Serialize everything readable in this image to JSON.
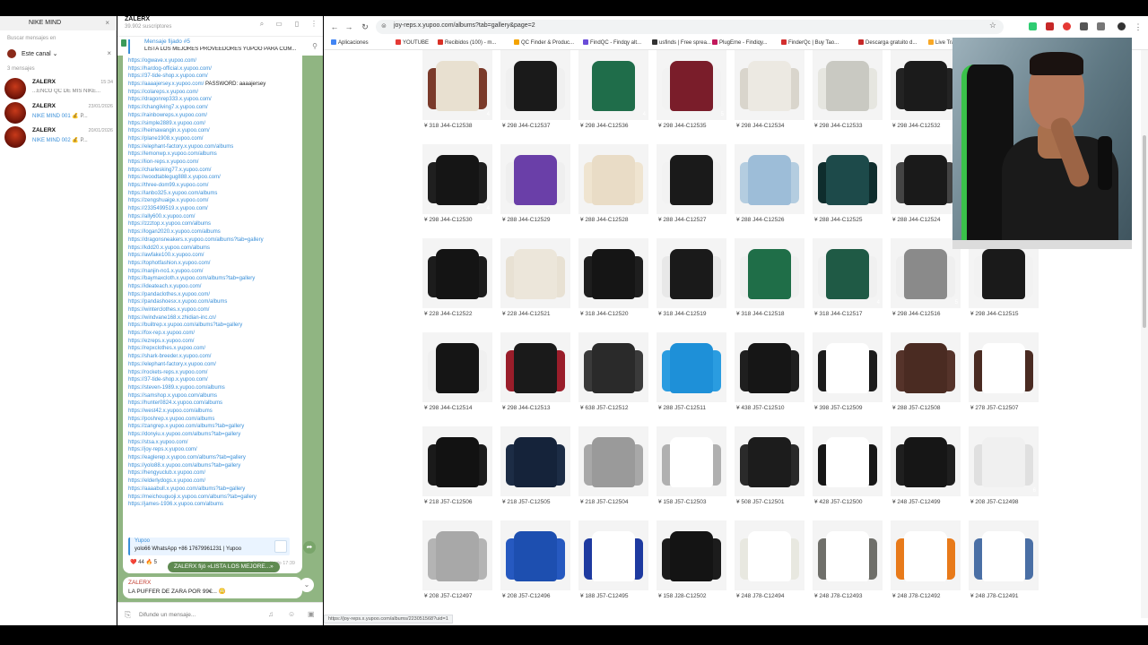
{
  "telegram": {
    "list_search": "NIKE MIND",
    "search_label": "Buscar mensajes en",
    "channel_filter": "Este canal",
    "message_count": "3 mensajes",
    "chats": [
      {
        "name": "ZALERX",
        "time": "15:34",
        "preview_blue": "",
        "preview": "...ENCO QC DE MIS NIKE..."
      },
      {
        "name": "ZALERX",
        "time": "23/01/2026",
        "preview_blue": "NIKE MIND 001",
        "preview": "💰 P..."
      },
      {
        "name": "ZALERX",
        "time": "20/01/2026",
        "preview_blue": "NIKE MIND 002",
        "preview": "💰 P..."
      }
    ],
    "channel_title": "ZALERX",
    "channel_subs": "39.902 suscriptores",
    "pinned_title": "Mensaje fijado #5",
    "pinned_text": "LISTA LOS MEJORES PROVEEDORES YUPOO PARA COM...",
    "links": [
      "https://ogwave.x.yupoo.com/",
      "https://hardog-official.x.yupoo.com/",
      "https://37-tide-shop.x.yupoo.com/",
      "https://aaaajersey.x.yupoo.com/",
      "https://colareps.x.yupoo.com/",
      "https://dragonrep333.x.yupoo.com/",
      "https://changliving7.x.yupoo.com/",
      "https://rainbowreps.x.yupoo.com/",
      "https://simple2889.x.yupoo.com/",
      "https://heimawangin.x.yupoo.com/",
      "https://plane1908.x.yupoo.com/",
      "https://elephant-factory.x.yupoo.com/albums",
      "https://lemonwp.x.yupoo.com/albums",
      "https://lion-reps.x.yupoo.com/",
      "https://charlesking77.x.yupoo.com/",
      "https://woodtablegug888.x.yupoo.com/",
      "https://three-dom99.x.yupoo.com/",
      "https://lanbo325.x.yupoo.com/albums",
      "https://zengshuaige.x.yupoo.com/",
      "https://2335499519.x.yupoo.com/",
      "https://ally600.x.yupoo.com/",
      "https://zzztop.x.yupoo.com/albums",
      "https://logan2020.x.yupoo.com/albums",
      "https://dragonsneakers.x.yupoo.com/albums?tab=gallery",
      "https://kdd20.x.yupoo.com/albums",
      "https://awfake100.x.yupoo.com/",
      "https://tophotfashion.x.yupoo.com/",
      "https://nanjin-no1.x.yupoo.com/",
      "https://baymaxcloth.x.yupoo.com/albums?tab=gallery",
      "https://ideateach.x.yupoo.com/",
      "https://pandaclothes.x.yupoo.com/",
      "https://pandashoesx.x.yupoo.com/albums",
      "https://winterclothes.x.yupoo.com/",
      "https://windvane168.x.zhidian-inc.cn/",
      "https://builtrep.x.yupoo.com/albums?tab=gallery",
      "https://fox-rep.x.yupoo.com/",
      "https://ezreps.x.yupoo.com/",
      "https://repxclothes.x.yupoo.com/",
      "https://shark-breeder.x.yupoo.com/",
      "https://elephant-factory.x.yupoo.com/",
      "https://rockets-reps.x.yupoo.com/",
      "https://37-tide-shop.x.yupoo.com/",
      "https://steven-1989.x.yupoo.com/albums",
      "https://samshop.x.yupoo.com/albums",
      "https://hunter0824.x.yupoo.com/albums",
      "https://west42.x.yupoo.com/albums",
      "https://poshrep.x.yupoo.com/albums",
      "https://zangrep.x.yupoo.com/albums?tab=gallery",
      "https://donyiu.x.yupoo.com/albums?tab=gallery",
      "https://stsa.x.yupoo.com/",
      "https://joy-reps.x.yupoo.com/",
      "https://eaglerep.x.yupoo.com/albums?tab=gallery",
      "https://yolo88.x.yupoo.com/albums?tab=gallery",
      "https://hengyuclub.x.yupoo.com/",
      "https://elderlydogs.x.yupoo.com/",
      "https://aaaabull.x.yupoo.com/albums?tab=gallery",
      "https://meichouguoji.x.yupoo.com/albums?tab=gallery",
      "https://james-1936.x.yupoo.com/albums"
    ],
    "password_text": "PASSWORD: aaaajersey",
    "quote_title": "Yupoo",
    "quote_text": "yolo66 WhatsApp +86 17679961231 | Yupoo",
    "reactions": "❤️ 44   🔥 5",
    "views": "9686",
    "edited": "editado 17:39",
    "service_msg": "ZALERX fijó «LISTA LOS MEJORE...»",
    "msg2_author": "ZALERX",
    "msg2_text": "LA PUFFER DE ZARA POR 99€... 😳",
    "compose_placeholder": "Difunde un mensaje..."
  },
  "browser": {
    "url": "joy-reps.x.yupoo.com/albums?tab=gallery&page=2",
    "status_url": "https://joy-reps.x.yupoo.com/albums/223051568?uid=1",
    "bookmarks": [
      {
        "label": "Aplicaciones",
        "color": "#4285f4"
      },
      {
        "label": "YOUTUBE",
        "color": "#e53935"
      },
      {
        "label": "Recibidos (100) - m...",
        "color": "#d93025"
      },
      {
        "label": "QC Finder & Produc...",
        "color": "#f4a300"
      },
      {
        "label": "FindQC - Findqy alt...",
        "color": "#6a4cd8"
      },
      {
        "label": "usfinds | Free sprea...",
        "color": "#333333"
      },
      {
        "label": "PlugEme - Findiqy...",
        "color": "#c2185b"
      },
      {
        "label": "FinderQc | Buy Tao...",
        "color": "#d32f2f"
      },
      {
        "label": "Descarga gratuito d...",
        "color": "#c62828"
      },
      {
        "label": "Live Track",
        "color": "#f9a825"
      }
    ],
    "grid": [
      [
        {
          "label": "¥ 318 J44-C12538",
          "n": "4",
          "color": "#e8e0d0",
          "sleeve": "#7a3a2a"
        },
        {
          "label": "¥ 298 J44-C12537",
          "n": "",
          "color": "#1a1a1a",
          "sleeve": "#f0f0f0"
        },
        {
          "label": "¥ 298 J44-C12536",
          "n": "4",
          "color": "#1f6d4a",
          "sleeve": "#f4f4f4"
        },
        {
          "label": "¥ 298 J44-C12535",
          "n": "5",
          "color": "#7a1d2a",
          "sleeve": "#f2f2f2"
        },
        {
          "label": "¥ 298 J44-C12534",
          "n": "",
          "color": "#ece9e2",
          "sleeve": "#d9d5cc"
        },
        {
          "label": "¥ 298 J44-C12533",
          "n": "",
          "color": "#c9c9c2",
          "sleeve": "#e6e6e0"
        },
        {
          "label": "¥ 298 J44-C12532",
          "n": "",
          "color": "#1b1b1b",
          "sleeve": "#232323"
        }
      ],
      [
        {
          "label": "¥ 298 J44-C12530",
          "n": "4",
          "color": "#151515",
          "sleeve": "#1f1f1f"
        },
        {
          "label": "¥ 288 J44-C12529",
          "n": "",
          "color": "#6a3fa8",
          "sleeve": "#efefef"
        },
        {
          "label": "¥ 288 J44-C12528",
          "n": "",
          "color": "#e9dcc6",
          "sleeve": "#efe4d0"
        },
        {
          "label": "¥ 288 J44-C12527",
          "n": "",
          "color": "#1a1a1a",
          "sleeve": "#f2f2f2"
        },
        {
          "label": "¥ 288 J44-C12526",
          "n": "",
          "color": "#9dbdd8",
          "sleeve": "#b4cde0"
        },
        {
          "label": "¥ 288 J44-C12525",
          "n": "",
          "color": "#1d4a4a",
          "sleeve": "#0f2d2d"
        },
        {
          "label": "¥ 288 J44-C12524",
          "n": "",
          "color": "#1a1a1a",
          "sleeve": "#444444"
        }
      ],
      [
        {
          "label": "¥ 228 J44-C12522",
          "n": "",
          "color": "#141414",
          "sleeve": "#1c1c1c"
        },
        {
          "label": "¥ 228 J44-C12521",
          "n": "",
          "color": "#ece6da",
          "sleeve": "#e8e1d3"
        },
        {
          "label": "¥ 318 J44-C12520",
          "n": "",
          "color": "#151515",
          "sleeve": "#1e1e1e"
        },
        {
          "label": "¥ 318 J44-C12519",
          "n": "",
          "color": "#1a1a1a",
          "sleeve": "#e8e8e8"
        },
        {
          "label": "¥ 318 J44-C12518",
          "n": "",
          "color": "#1f6e48",
          "sleeve": "#f0f0f0"
        },
        {
          "label": "¥ 318 J44-C12517",
          "n": "4",
          "color": "#1f5a45",
          "sleeve": "#f0f0f0"
        },
        {
          "label": "¥ 298 J44-C12516",
          "n": "5",
          "color": "#8a8a8a",
          "sleeve": "#efefef"
        },
        {
          "label": "¥ 298 J44-C12515",
          "n": "",
          "color": "#1a1a1a",
          "sleeve": "#f2f2f2"
        }
      ],
      [
        {
          "label": "¥ 298 J44-C12514",
          "n": "",
          "color": "#151515",
          "sleeve": "#f0f0f0"
        },
        {
          "label": "¥ 298 J44-C12513",
          "n": "",
          "color": "#1a1a1a",
          "sleeve": "#9a1d2a"
        },
        {
          "label": "¥ 638 J57-C12512",
          "n": "",
          "color": "#2a2a2a",
          "sleeve": "#3a3a3a"
        },
        {
          "label": "¥ 288 J57-C12511",
          "n": "",
          "color": "#1e90d8",
          "sleeve": "#2a9ce0"
        },
        {
          "label": "¥ 438 J57-C12510",
          "n": "",
          "color": "#161616",
          "sleeve": "#1f1f1f"
        },
        {
          "label": "¥ 398 J57-C12509",
          "n": "",
          "color": "#ffffff",
          "sleeve": "#1b1b1b"
        },
        {
          "label": "¥ 288 J57-C12508",
          "n": "",
          "color": "#4a2b22",
          "sleeve": "#55332a"
        },
        {
          "label": "¥ 278 J57-C12507",
          "n": "",
          "color": "#ffffff",
          "sleeve": "#4a2b22"
        }
      ],
      [
        {
          "label": "¥ 218 J57-C12506",
          "n": "",
          "color": "#121212",
          "sleeve": "#1a1a1a"
        },
        {
          "label": "¥ 218 J57-C12505",
          "n": "",
          "color": "#15233a",
          "sleeve": "#1c2c45"
        },
        {
          "label": "¥ 218 J57-C12504",
          "n": "",
          "color": "#9a9a9a",
          "sleeve": "#a8a8a8"
        },
        {
          "label": "¥ 158 J57-C12503",
          "n": "",
          "color": "#ffffff",
          "sleeve": "#b0b0b0"
        },
        {
          "label": "¥ 508 J57-C12501",
          "n": "",
          "color": "#1c1c1c",
          "sleeve": "#2a2a2a"
        },
        {
          "label": "¥ 428 J57-C12500",
          "n": "",
          "color": "#ffffff",
          "sleeve": "#161616"
        },
        {
          "label": "¥ 248 J57-C12499",
          "n": "",
          "color": "#161616",
          "sleeve": "#1f1f1f"
        },
        {
          "label": "¥ 208 J57-C12498",
          "n": "6",
          "color": "#f0f0f0",
          "sleeve": "#e0e0e0"
        }
      ],
      [
        {
          "label": "¥ 208 J57-C12497",
          "n": "",
          "color": "#a8a8a8",
          "sleeve": "#b4b4b4"
        },
        {
          "label": "¥ 208 J57-C12496",
          "n": "",
          "color": "#1d4fb0",
          "sleeve": "#2659c0"
        },
        {
          "label": "¥ 188 J57-C12495",
          "n": "",
          "color": "#ffffff",
          "sleeve": "#1e3aa0"
        },
        {
          "label": "¥ 158 J28-C12502",
          "n": "",
          "color": "#141414",
          "sleeve": "#1c1c1c"
        },
        {
          "label": "¥ 248 J78-C12494",
          "n": "",
          "color": "#ffffff",
          "sleeve": "#e8e8e0"
        },
        {
          "label": "¥ 248 J78-C12493",
          "n": "",
          "color": "#ffffff",
          "sleeve": "#6f6f6a"
        },
        {
          "label": "¥ 248 J78-C12492",
          "n": "",
          "color": "#ffffff",
          "sleeve": "#e87a1a"
        },
        {
          "label": "¥ 248 J78-C12491",
          "n": "",
          "color": "#ffffff",
          "sleeve": "#4a6fa5"
        }
      ]
    ]
  }
}
